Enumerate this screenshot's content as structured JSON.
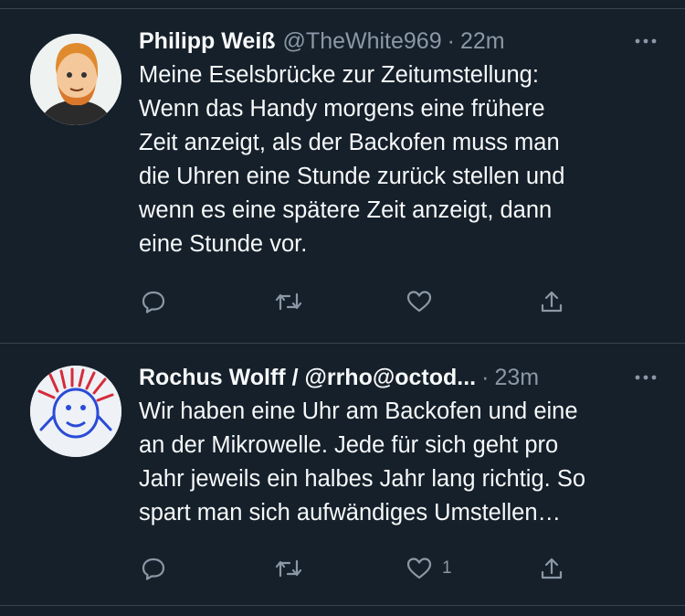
{
  "tweets": [
    {
      "name": "Philipp Weiß",
      "handle": "@TheWhite969",
      "separator": "·",
      "time": "22m",
      "text": "Meine Eselsbrücke zur Zeitumstellung:\nWenn das Handy morgens eine frühere\nZeit anzeigt, als der Backofen muss man\ndie Uhren eine Stunde zurück stellen und\nwenn es eine spätere Zeit anzeigt, dann\neine Stunde vor.",
      "like_count": ""
    },
    {
      "name": "Rochus Wolff / @rrho@octod...",
      "handle": "",
      "separator": "·",
      "time": "23m",
      "text": "Wir haben eine Uhr am Backofen und eine\nan der Mikrowelle. Jede für sich geht pro\nJahr jeweils ein halbes Jahr lang richtig. So\nspart man sich aufwändiges Umstellen…",
      "like_count": "1"
    }
  ],
  "icons": [
    "more-icon",
    "reply-icon",
    "retweet-icon",
    "like-icon",
    "share-icon"
  ],
  "colors": {
    "background": "#15202b",
    "text": "#f7f9f9",
    "muted": "#8b98a5",
    "divider": "#38444d"
  }
}
